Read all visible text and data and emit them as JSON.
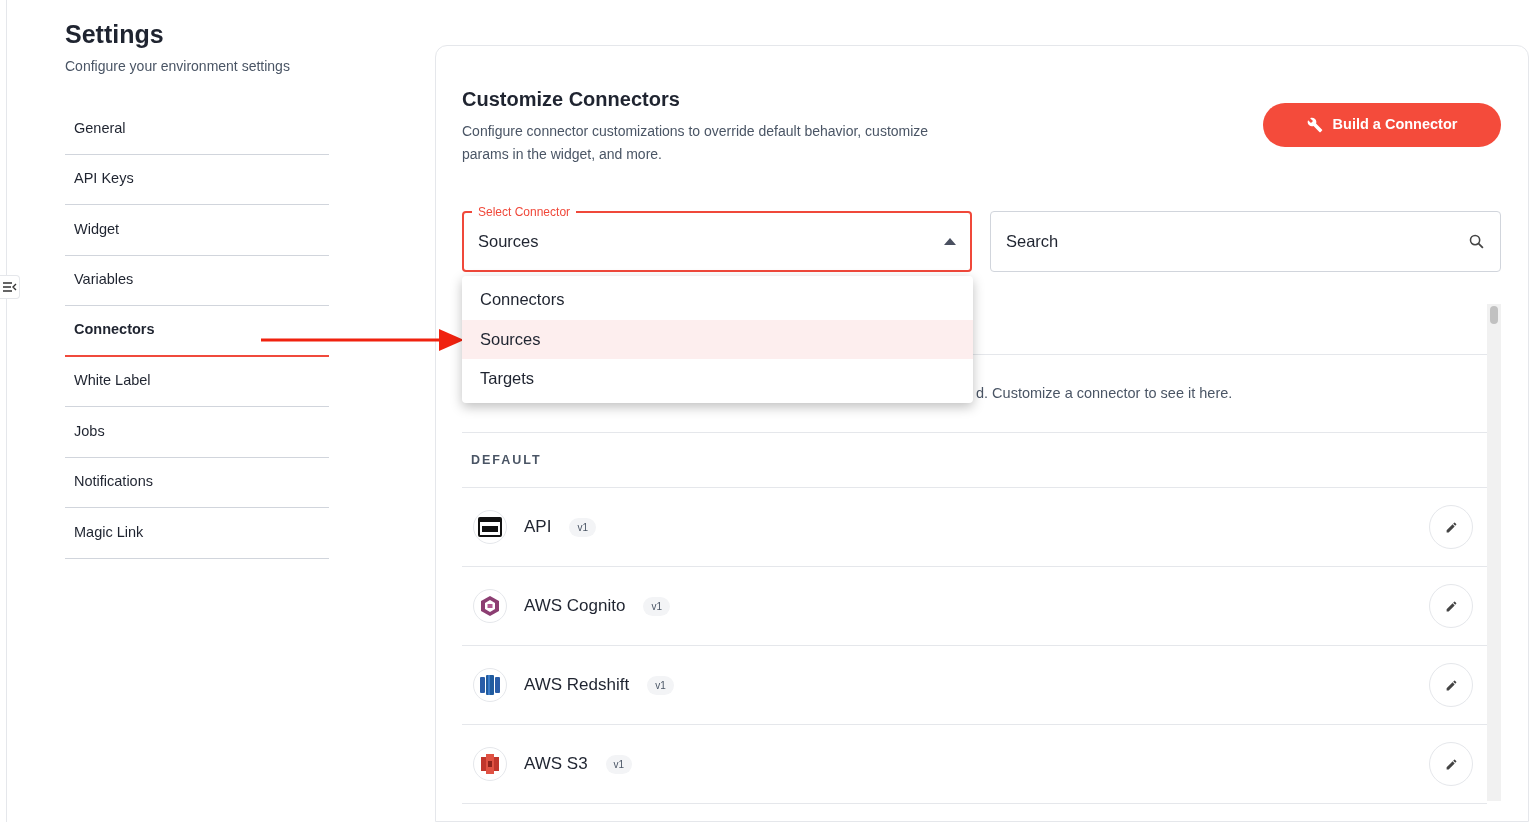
{
  "sidebar": {
    "title": "Settings",
    "subtitle": "Configure your environment settings",
    "items": [
      {
        "label": "General",
        "selected": false
      },
      {
        "label": "API Keys",
        "selected": false
      },
      {
        "label": "Widget",
        "selected": false
      },
      {
        "label": "Variables",
        "selected": false
      },
      {
        "label": "Connectors",
        "selected": true
      },
      {
        "label": "White Label",
        "selected": false
      },
      {
        "label": "Jobs",
        "selected": false
      },
      {
        "label": "Notifications",
        "selected": false
      },
      {
        "label": "Magic Link",
        "selected": false
      }
    ]
  },
  "page": {
    "title": "Customize Connectors",
    "description": "Configure connector customizations to override default behavior, customize params in the widget, and more.",
    "build_button": "Build a Connector"
  },
  "select": {
    "label": "Select Connector",
    "value": "Sources",
    "expanded": true,
    "options": [
      {
        "label": "Connectors",
        "selected": false
      },
      {
        "label": "Sources",
        "selected": true
      },
      {
        "label": "Targets",
        "selected": false
      }
    ]
  },
  "search": {
    "placeholder": "Search"
  },
  "customized_notice": "d. Customize a connector to see it here.",
  "section_label": "DEFAULT",
  "connectors": [
    {
      "name": "API",
      "version": "v1",
      "kind": "api"
    },
    {
      "name": "AWS Cognito",
      "version": "v1",
      "kind": "cognito"
    },
    {
      "name": "AWS Redshift",
      "version": "v1",
      "kind": "redshift"
    },
    {
      "name": "AWS S3",
      "version": "v1",
      "kind": "s3"
    }
  ]
}
